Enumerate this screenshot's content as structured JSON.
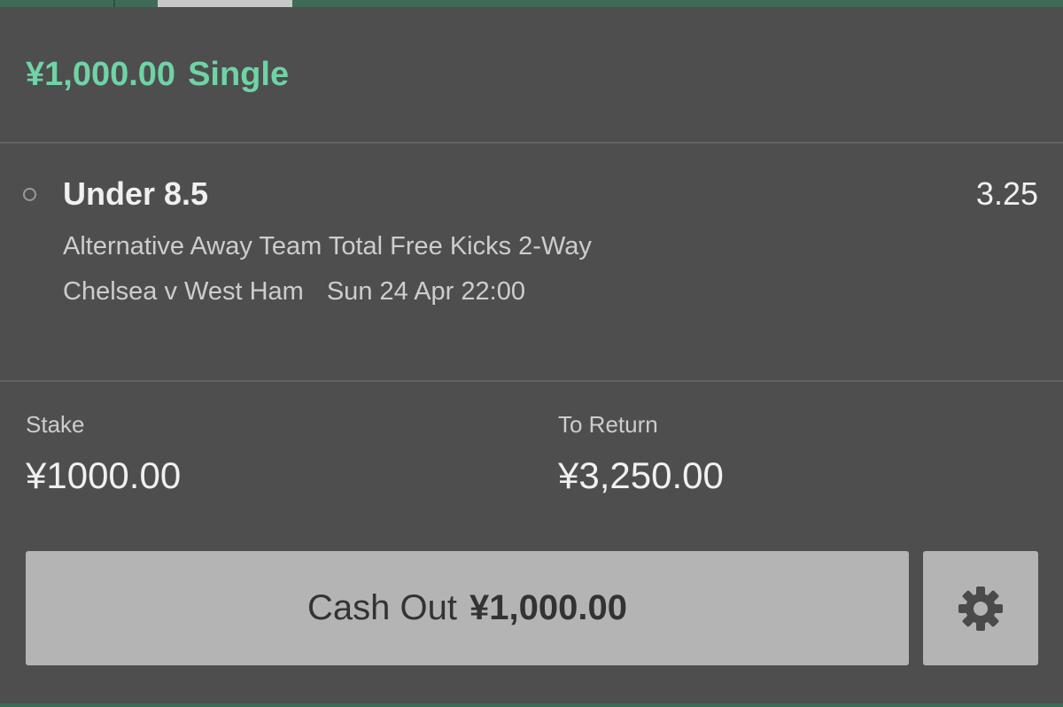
{
  "bet": {
    "stake_display": "¥1,000.00",
    "bet_type": "Single"
  },
  "selection": {
    "name": "Under 8.5",
    "odds": "3.25",
    "market": "Alternative Away Team Total Free Kicks 2-Way",
    "event": "Chelsea v West Ham",
    "event_time": "Sun 24 Apr 22:00"
  },
  "summary": {
    "stake_label": "Stake",
    "stake_value": "¥1000.00",
    "return_label": "To Return",
    "return_value": "¥3,250.00"
  },
  "actions": {
    "cashout_label": "Cash Out",
    "cashout_amount": "¥1,000.00",
    "settings_icon": "gear-icon"
  },
  "colors": {
    "background": "#4e4e4e",
    "accent_green": "#6fd3a5",
    "button_grey": "#b4b4b4"
  }
}
